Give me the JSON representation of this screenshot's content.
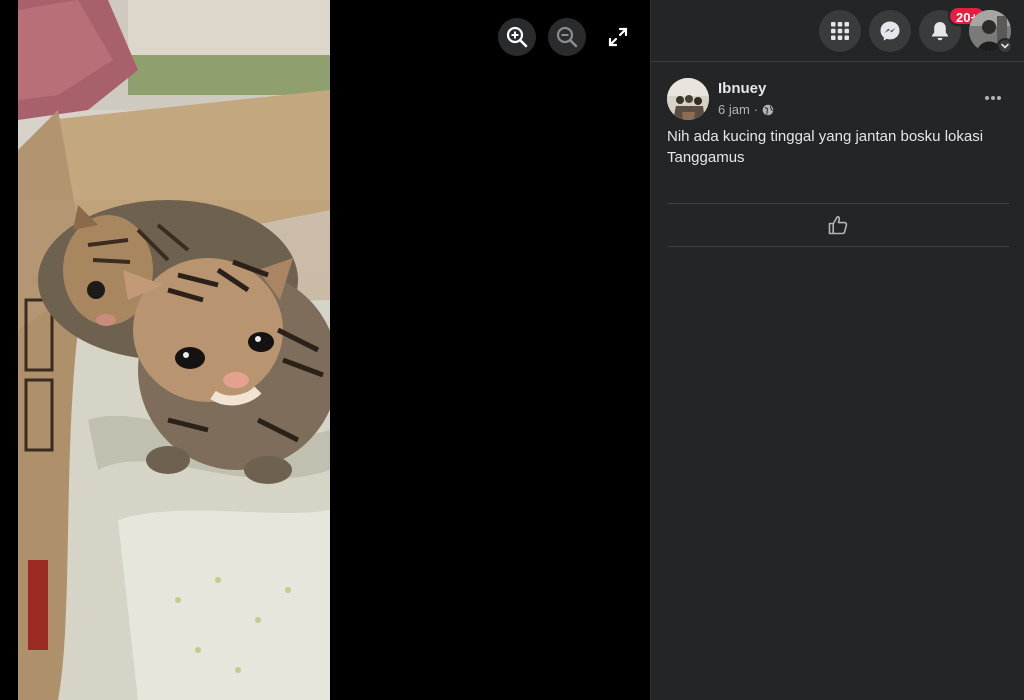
{
  "viewer": {
    "photo_alt": "Two leopard cat kittens in a cardboard box on a cloth",
    "icons": {
      "zoom_in": "zoom-in-icon",
      "zoom_out": "zoom-out-icon",
      "fullscreen": "fullscreen-icon"
    }
  },
  "topbar": {
    "icons": [
      "menu-grid-icon",
      "messenger-icon",
      "bell-icon"
    ],
    "notification_count": "20+"
  },
  "post": {
    "author": "Ibnuey",
    "time": "6 jam",
    "separator": "·",
    "privacy_icon": "globe-icon",
    "text": "Nih ada kucing tinggal yang jantan bosku lokasi Tanggamus",
    "actions": {
      "more_icon": "more-dots-icon",
      "like_icon": "thumbs-up-icon"
    }
  },
  "colors": {
    "panel_bg": "#242526",
    "button_bg": "#3a3b3c",
    "text_primary": "#e4e6eb",
    "text_secondary": "#b0b3b8",
    "badge": "#e41e3f"
  }
}
